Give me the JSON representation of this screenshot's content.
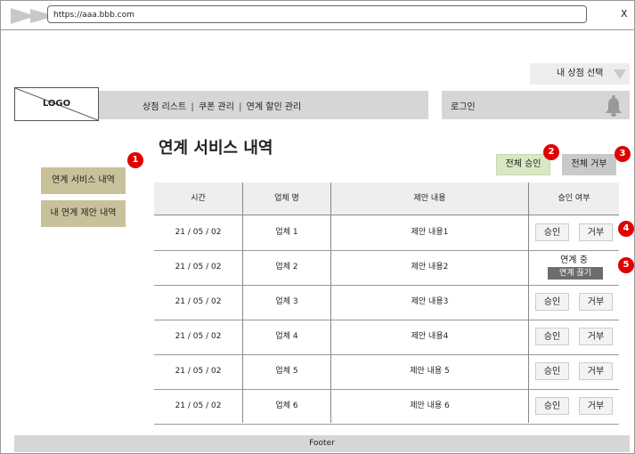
{
  "browser": {
    "url": "https://aaa.bbb.com",
    "close": "X"
  },
  "store_select": {
    "label": "내 상점 선택"
  },
  "header": {
    "logo": "LOGO",
    "nav": [
      "상점 리스트",
      "쿠폰 관리",
      "연계 할인 관리"
    ],
    "nav_separator": "|",
    "login": "로그인"
  },
  "sidebar": {
    "items": [
      {
        "label": "연계 서비스 내역"
      },
      {
        "label": "내 연계 제안 내역"
      }
    ]
  },
  "page": {
    "title": "연계 서비스 내역",
    "approve_all": "전체 승인",
    "reject_all": "전체 거부"
  },
  "markers": [
    "1",
    "2",
    "3",
    "4",
    "5"
  ],
  "table": {
    "headers": [
      "시간",
      "업체 명",
      "제안 내용",
      "승인 여부"
    ],
    "rows": [
      {
        "time": "21 / 05 / 02",
        "company": "업체 1",
        "proposal": "제안 내용1",
        "status": "buttons"
      },
      {
        "time": "21 / 05 / 02",
        "company": "업체 2",
        "proposal": "제안 내용2",
        "status": "linked",
        "status_text": "연계 중",
        "unlink": "연계 끊기"
      },
      {
        "time": "21 / 05 / 02",
        "company": "업체 3",
        "proposal": "제안 내용3",
        "status": "buttons"
      },
      {
        "time": "21 / 05 / 02",
        "company": "업체 4",
        "proposal": "제안 내용4",
        "status": "buttons"
      },
      {
        "time": "21 / 05 / 02",
        "company": "업체 5",
        "proposal": "제안 내용 5",
        "status": "buttons"
      },
      {
        "time": "21 / 05 / 02",
        "company": "업체 6",
        "proposal": "제안 내용 6",
        "status": "buttons"
      }
    ],
    "approve_label": "승인",
    "reject_label": "거부"
  },
  "footer": {
    "label": "Footer"
  }
}
